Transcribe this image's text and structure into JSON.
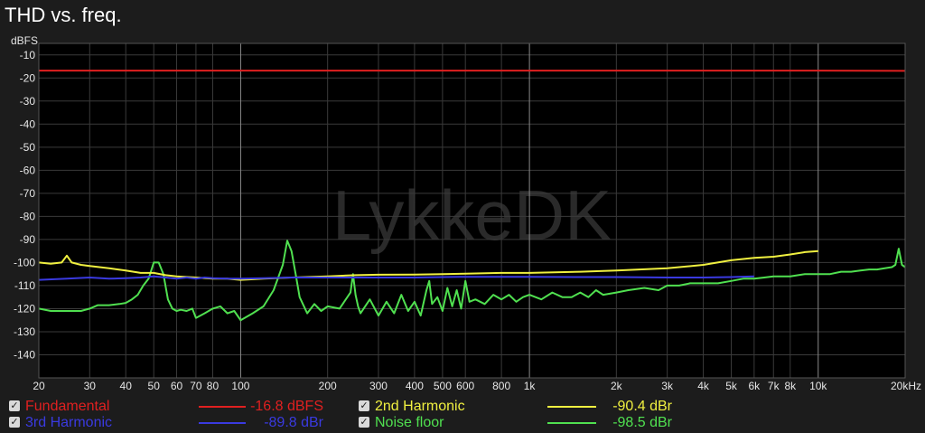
{
  "chart_data": {
    "type": "line",
    "title": "THD vs. freq.",
    "ylabel": "dBFS",
    "xlabel": "",
    "xscale": "log",
    "xlim": [
      20,
      20000
    ],
    "ylim": [
      -150,
      -5
    ],
    "grid": true,
    "watermark": "LykkeDK",
    "x_ticks": [
      {
        "v": 20,
        "label": "20"
      },
      {
        "v": 30,
        "label": "30"
      },
      {
        "v": 40,
        "label": "40"
      },
      {
        "v": 50,
        "label": "50"
      },
      {
        "v": 60,
        "label": "60"
      },
      {
        "v": 70,
        "label": "70"
      },
      {
        "v": 80,
        "label": "80"
      },
      {
        "v": 100,
        "label": "100"
      },
      {
        "v": 200,
        "label": "200"
      },
      {
        "v": 300,
        "label": "300"
      },
      {
        "v": 400,
        "label": "400"
      },
      {
        "v": 500,
        "label": "500"
      },
      {
        "v": 600,
        "label": "600"
      },
      {
        "v": 800,
        "label": "800"
      },
      {
        "v": 1000,
        "label": "1k"
      },
      {
        "v": 2000,
        "label": "2k"
      },
      {
        "v": 3000,
        "label": "3k"
      },
      {
        "v": 4000,
        "label": "4k"
      },
      {
        "v": 5000,
        "label": "5k"
      },
      {
        "v": 6000,
        "label": "6k"
      },
      {
        "v": 7000,
        "label": "7k"
      },
      {
        "v": 8000,
        "label": "8k"
      },
      {
        "v": 10000,
        "label": "10k"
      },
      {
        "v": 20000,
        "label": "20kHz"
      }
    ],
    "y_ticks": [
      -10,
      -20,
      -30,
      -40,
      -50,
      -60,
      -70,
      -80,
      -90,
      -100,
      -110,
      -120,
      -130,
      -140
    ],
    "series": [
      {
        "name": "Fundamental",
        "color": "#e02020",
        "value_label": "-16.8 dBFS",
        "x": [
          20,
          100,
          1000,
          10000,
          20000
        ],
        "y": [
          -16.8,
          -16.8,
          -16.8,
          -16.8,
          -16.9
        ]
      },
      {
        "name": "3rd Harmonic",
        "color": "#3a3ae0",
        "value_label": "-89.8 dBr",
        "x": [
          20,
          25,
          30,
          35,
          40,
          45,
          50,
          55,
          60,
          65,
          70,
          75,
          80,
          90,
          100,
          120,
          150,
          200,
          250,
          300,
          400,
          500,
          600,
          800,
          1000,
          1500,
          2000,
          3000,
          4000,
          5000,
          6000
        ],
        "y": [
          -107.5,
          -107,
          -106.5,
          -107,
          -106.8,
          -106.5,
          -106,
          -106.5,
          -107,
          -106.5,
          -107,
          -106.5,
          -106.8,
          -107,
          -107,
          -106.8,
          -106.5,
          -106.5,
          -106.5,
          -106.5,
          -106.5,
          -106.3,
          -106.2,
          -106.2,
          -106.2,
          -106.3,
          -106.3,
          -106.5,
          -106.5,
          -106.3,
          -106
        ]
      },
      {
        "name": "2nd Harmonic",
        "color": "#f0f040",
        "value_label": "-90.4 dBr",
        "x": [
          20,
          22,
          24,
          25,
          26,
          28,
          30,
          35,
          40,
          45,
          50,
          55,
          60,
          70,
          80,
          90,
          100,
          120,
          150,
          200,
          250,
          300,
          400,
          500,
          600,
          800,
          1000,
          1500,
          2000,
          3000,
          4000,
          5000,
          6000,
          7000,
          8000,
          9000,
          10000
        ],
        "y": [
          -100,
          -100.5,
          -100,
          -97,
          -100,
          -101,
          -101.5,
          -102.5,
          -103.5,
          -104.5,
          -104.5,
          -105.5,
          -106,
          -106.5,
          -107,
          -107,
          -107.5,
          -107,
          -106.5,
          -106,
          -105.5,
          -105.3,
          -105.2,
          -105,
          -104.8,
          -104.5,
          -104.5,
          -104,
          -103.5,
          -102.5,
          -101,
          -99,
          -98,
          -97.5,
          -96.5,
          -95.5,
          -95
        ]
      },
      {
        "name": "Noise floor",
        "color": "#50e050",
        "value_label": "-98.5 dBr",
        "x": [
          20,
          22,
          25,
          28,
          30,
          32,
          35,
          38,
          40,
          42,
          44,
          46,
          48,
          50,
          52,
          54,
          56,
          58,
          60,
          62,
          65,
          68,
          70,
          75,
          80,
          85,
          90,
          95,
          100,
          110,
          120,
          130,
          140,
          145,
          150,
          155,
          160,
          170,
          180,
          190,
          200,
          220,
          240,
          245,
          250,
          255,
          260,
          280,
          300,
          320,
          340,
          360,
          380,
          400,
          420,
          440,
          450,
          460,
          480,
          500,
          520,
          540,
          560,
          580,
          600,
          620,
          650,
          700,
          750,
          800,
          850,
          900,
          950,
          1000,
          1100,
          1200,
          1300,
          1400,
          1500,
          1600,
          1700,
          1800,
          2000,
          2200,
          2500,
          2800,
          3000,
          3300,
          3600,
          4000,
          4500,
          5000,
          5500,
          6000,
          6500,
          7000,
          8000,
          9000,
          10000,
          11000,
          12000,
          13000,
          14000,
          15000,
          16000,
          17000,
          18000,
          18500,
          19000,
          19500,
          20000
        ],
        "y": [
          -120,
          -121,
          -121,
          -121,
          -120,
          -118.5,
          -118.5,
          -118,
          -117.5,
          -116,
          -114,
          -110,
          -107,
          -100,
          -100,
          -105,
          -116,
          -120,
          -121,
          -120.5,
          -121,
          -120,
          -124,
          -122,
          -120,
          -119,
          -122,
          -121,
          -125,
          -122,
          -119,
          -112,
          -101,
          -90.5,
          -95,
          -105,
          -115,
          -122,
          -118,
          -121,
          -119,
          -120,
          -113,
          -105,
          -114,
          -119,
          -122,
          -116,
          -123,
          -117,
          -122,
          -114,
          -121,
          -117,
          -123,
          -112,
          -108,
          -118,
          -115,
          -121,
          -111,
          -119,
          -112,
          -120,
          -108,
          -117,
          -116,
          -118,
          -114,
          -116,
          -114,
          -117,
          -115,
          -114,
          -116,
          -113,
          -115,
          -115,
          -113,
          -115,
          -112,
          -114,
          -113,
          -112,
          -111,
          -112,
          -110,
          -110,
          -109,
          -109,
          -109,
          -108,
          -107,
          -107,
          -106.5,
          -106,
          -106,
          -105,
          -105,
          -105,
          -104,
          -104,
          -103.5,
          -103,
          -103,
          -102.5,
          -102,
          -101,
          -94,
          -101,
          -102
        ]
      }
    ]
  },
  "legend": [
    {
      "name": "Fundamental",
      "value": "-16.8 dBFS",
      "color": "#e02020",
      "checked": true
    },
    {
      "name": "2nd Harmonic",
      "value": "-90.4 dBr",
      "color": "#f0f040",
      "checked": true
    },
    {
      "name": "3rd Harmonic",
      "value": "-89.8 dBr",
      "color": "#3a3ae0",
      "checked": true
    },
    {
      "name": "Noise floor",
      "value": "-98.5 dBr",
      "color": "#50e050",
      "checked": true
    }
  ],
  "checkbox_glyph": "✓"
}
